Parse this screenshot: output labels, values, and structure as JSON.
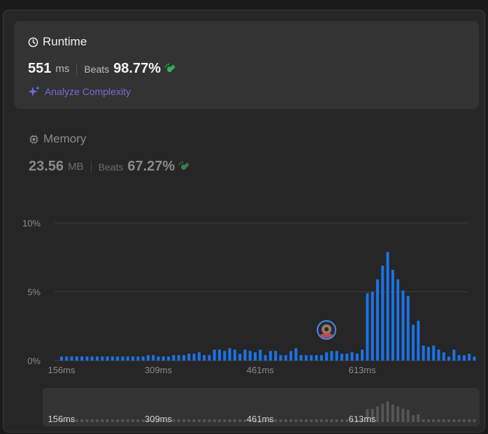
{
  "runtime": {
    "title": "Runtime",
    "value": "551",
    "unit": "ms",
    "beats_label": "Beats",
    "beats_pct": "98.77%",
    "analyze_label": "Analyze Complexity"
  },
  "memory": {
    "title": "Memory",
    "value": "23.56",
    "unit": "MB",
    "beats_label": "Beats",
    "beats_pct": "67.27%"
  },
  "colors": {
    "bar": "#1a73e8",
    "brush_bar": "#555555",
    "grid": "#3e3e3e",
    "beats_icon_active": "#2db55d",
    "beats_icon_dim": "#3b7a4d",
    "analyze": "#7c68d6"
  },
  "icons": {
    "runtime": "clock-icon",
    "memory": "chip-icon",
    "analyze": "sparkle-icon",
    "beats": "clap-icon",
    "marker": "avatar"
  },
  "chart_data": {
    "type": "bar",
    "ylim": [
      0,
      10
    ],
    "y_ticks": [
      {
        "value": 0,
        "label": "0%"
      },
      {
        "value": 5,
        "label": "5%"
      },
      {
        "value": 10,
        "label": "10%"
      }
    ],
    "x_tick_labels": [
      "156ms",
      "309ms",
      "461ms",
      "613ms"
    ],
    "x_tick_indices": [
      0,
      19,
      39,
      59
    ],
    "highlighted_bar_index": 52,
    "values": [
      0.3,
      0.3,
      0.3,
      0.3,
      0.3,
      0.3,
      0.3,
      0.3,
      0.3,
      0.3,
      0.3,
      0.3,
      0.3,
      0.3,
      0.3,
      0.3,
      0.3,
      0.4,
      0.4,
      0.3,
      0.3,
      0.3,
      0.4,
      0.4,
      0.4,
      0.5,
      0.5,
      0.6,
      0.4,
      0.4,
      0.8,
      0.8,
      0.7,
      0.9,
      0.8,
      0.5,
      0.8,
      0.7,
      0.6,
      0.8,
      0.4,
      0.7,
      0.7,
      0.4,
      0.4,
      0.7,
      0.9,
      0.4,
      0.4,
      0.4,
      0.4,
      0.4,
      0.6,
      0.7,
      0.7,
      0.5,
      0.5,
      0.6,
      0.5,
      0.8,
      4.9,
      5.0,
      5.9,
      6.9,
      7.9,
      6.6,
      5.9,
      5.1,
      4.7,
      2.6,
      2.9,
      1.1,
      1.0,
      1.1,
      0.8,
      0.6,
      0.3,
      0.8,
      0.4,
      0.4,
      0.5,
      0.3
    ]
  }
}
